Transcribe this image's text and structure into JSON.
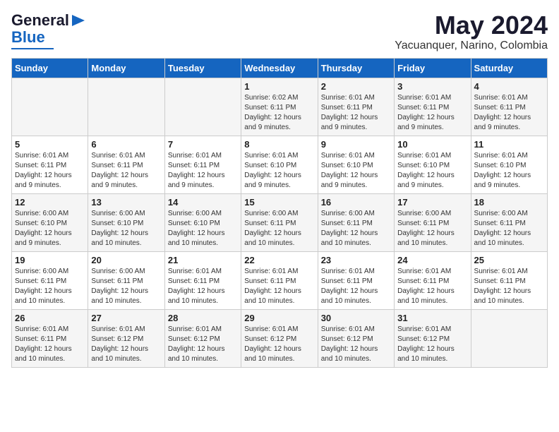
{
  "brand": {
    "name_line1": "General",
    "name_line2": "Blue"
  },
  "title": "May 2024",
  "subtitle": "Yacuanquer, Narino, Colombia",
  "weekdays": [
    "Sunday",
    "Monday",
    "Tuesday",
    "Wednesday",
    "Thursday",
    "Friday",
    "Saturday"
  ],
  "weeks": [
    [
      {
        "day": "",
        "sunrise": "",
        "sunset": "",
        "daylight": ""
      },
      {
        "day": "",
        "sunrise": "",
        "sunset": "",
        "daylight": ""
      },
      {
        "day": "",
        "sunrise": "",
        "sunset": "",
        "daylight": ""
      },
      {
        "day": "1",
        "sunrise": "Sunrise: 6:02 AM",
        "sunset": "Sunset: 6:11 PM",
        "daylight": "Daylight: 12 hours and 9 minutes."
      },
      {
        "day": "2",
        "sunrise": "Sunrise: 6:01 AM",
        "sunset": "Sunset: 6:11 PM",
        "daylight": "Daylight: 12 hours and 9 minutes."
      },
      {
        "day": "3",
        "sunrise": "Sunrise: 6:01 AM",
        "sunset": "Sunset: 6:11 PM",
        "daylight": "Daylight: 12 hours and 9 minutes."
      },
      {
        "day": "4",
        "sunrise": "Sunrise: 6:01 AM",
        "sunset": "Sunset: 6:11 PM",
        "daylight": "Daylight: 12 hours and 9 minutes."
      }
    ],
    [
      {
        "day": "5",
        "sunrise": "Sunrise: 6:01 AM",
        "sunset": "Sunset: 6:11 PM",
        "daylight": "Daylight: 12 hours and 9 minutes."
      },
      {
        "day": "6",
        "sunrise": "Sunrise: 6:01 AM",
        "sunset": "Sunset: 6:11 PM",
        "daylight": "Daylight: 12 hours and 9 minutes."
      },
      {
        "day": "7",
        "sunrise": "Sunrise: 6:01 AM",
        "sunset": "Sunset: 6:11 PM",
        "daylight": "Daylight: 12 hours and 9 minutes."
      },
      {
        "day": "8",
        "sunrise": "Sunrise: 6:01 AM",
        "sunset": "Sunset: 6:10 PM",
        "daylight": "Daylight: 12 hours and 9 minutes."
      },
      {
        "day": "9",
        "sunrise": "Sunrise: 6:01 AM",
        "sunset": "Sunset: 6:10 PM",
        "daylight": "Daylight: 12 hours and 9 minutes."
      },
      {
        "day": "10",
        "sunrise": "Sunrise: 6:01 AM",
        "sunset": "Sunset: 6:10 PM",
        "daylight": "Daylight: 12 hours and 9 minutes."
      },
      {
        "day": "11",
        "sunrise": "Sunrise: 6:01 AM",
        "sunset": "Sunset: 6:10 PM",
        "daylight": "Daylight: 12 hours and 9 minutes."
      }
    ],
    [
      {
        "day": "12",
        "sunrise": "Sunrise: 6:00 AM",
        "sunset": "Sunset: 6:10 PM",
        "daylight": "Daylight: 12 hours and 9 minutes."
      },
      {
        "day": "13",
        "sunrise": "Sunrise: 6:00 AM",
        "sunset": "Sunset: 6:10 PM",
        "daylight": "Daylight: 12 hours and 10 minutes."
      },
      {
        "day": "14",
        "sunrise": "Sunrise: 6:00 AM",
        "sunset": "Sunset: 6:10 PM",
        "daylight": "Daylight: 12 hours and 10 minutes."
      },
      {
        "day": "15",
        "sunrise": "Sunrise: 6:00 AM",
        "sunset": "Sunset: 6:11 PM",
        "daylight": "Daylight: 12 hours and 10 minutes."
      },
      {
        "day": "16",
        "sunrise": "Sunrise: 6:00 AM",
        "sunset": "Sunset: 6:11 PM",
        "daylight": "Daylight: 12 hours and 10 minutes."
      },
      {
        "day": "17",
        "sunrise": "Sunrise: 6:00 AM",
        "sunset": "Sunset: 6:11 PM",
        "daylight": "Daylight: 12 hours and 10 minutes."
      },
      {
        "day": "18",
        "sunrise": "Sunrise: 6:00 AM",
        "sunset": "Sunset: 6:11 PM",
        "daylight": "Daylight: 12 hours and 10 minutes."
      }
    ],
    [
      {
        "day": "19",
        "sunrise": "Sunrise: 6:00 AM",
        "sunset": "Sunset: 6:11 PM",
        "daylight": "Daylight: 12 hours and 10 minutes."
      },
      {
        "day": "20",
        "sunrise": "Sunrise: 6:00 AM",
        "sunset": "Sunset: 6:11 PM",
        "daylight": "Daylight: 12 hours and 10 minutes."
      },
      {
        "day": "21",
        "sunrise": "Sunrise: 6:01 AM",
        "sunset": "Sunset: 6:11 PM",
        "daylight": "Daylight: 12 hours and 10 minutes."
      },
      {
        "day": "22",
        "sunrise": "Sunrise: 6:01 AM",
        "sunset": "Sunset: 6:11 PM",
        "daylight": "Daylight: 12 hours and 10 minutes."
      },
      {
        "day": "23",
        "sunrise": "Sunrise: 6:01 AM",
        "sunset": "Sunset: 6:11 PM",
        "daylight": "Daylight: 12 hours and 10 minutes."
      },
      {
        "day": "24",
        "sunrise": "Sunrise: 6:01 AM",
        "sunset": "Sunset: 6:11 PM",
        "daylight": "Daylight: 12 hours and 10 minutes."
      },
      {
        "day": "25",
        "sunrise": "Sunrise: 6:01 AM",
        "sunset": "Sunset: 6:11 PM",
        "daylight": "Daylight: 12 hours and 10 minutes."
      }
    ],
    [
      {
        "day": "26",
        "sunrise": "Sunrise: 6:01 AM",
        "sunset": "Sunset: 6:11 PM",
        "daylight": "Daylight: 12 hours and 10 minutes."
      },
      {
        "day": "27",
        "sunrise": "Sunrise: 6:01 AM",
        "sunset": "Sunset: 6:12 PM",
        "daylight": "Daylight: 12 hours and 10 minutes."
      },
      {
        "day": "28",
        "sunrise": "Sunrise: 6:01 AM",
        "sunset": "Sunset: 6:12 PM",
        "daylight": "Daylight: 12 hours and 10 minutes."
      },
      {
        "day": "29",
        "sunrise": "Sunrise: 6:01 AM",
        "sunset": "Sunset: 6:12 PM",
        "daylight": "Daylight: 12 hours and 10 minutes."
      },
      {
        "day": "30",
        "sunrise": "Sunrise: 6:01 AM",
        "sunset": "Sunset: 6:12 PM",
        "daylight": "Daylight: 12 hours and 10 minutes."
      },
      {
        "day": "31",
        "sunrise": "Sunrise: 6:01 AM",
        "sunset": "Sunset: 6:12 PM",
        "daylight": "Daylight: 12 hours and 10 minutes."
      },
      {
        "day": "",
        "sunrise": "",
        "sunset": "",
        "daylight": ""
      }
    ]
  ]
}
